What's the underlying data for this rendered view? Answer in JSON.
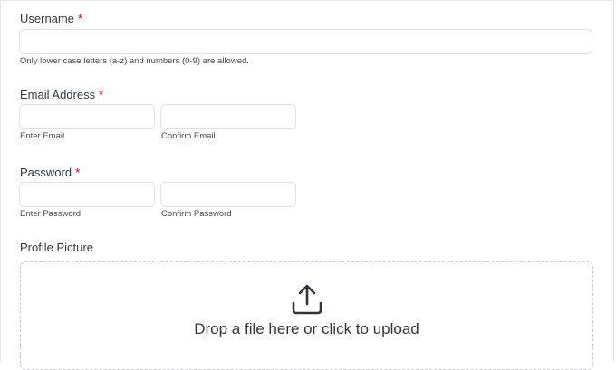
{
  "form": {
    "username": {
      "label": "Username",
      "required_mark": "*",
      "value": "",
      "placeholder": "",
      "hint": "Only lower case letters (a-z) and numbers (0-9) are allowed."
    },
    "email": {
      "label": "Email Address",
      "required_mark": "*",
      "enter_value": "",
      "confirm_value": "",
      "enter_hint": "Enter Email",
      "confirm_hint": "Confirm Email"
    },
    "password": {
      "label": "Password",
      "required_mark": "*",
      "enter_value": "",
      "confirm_value": "",
      "enter_hint": "Enter Password",
      "confirm_hint": "Confirm Password"
    },
    "profile_picture": {
      "label": "Profile Picture",
      "drop_text": "Drop a file here or click to upload",
      "icon": "upload-icon"
    }
  },
  "colors": {
    "required": "#d0021b",
    "text": "#333a41",
    "border": "#dfe3e6"
  }
}
